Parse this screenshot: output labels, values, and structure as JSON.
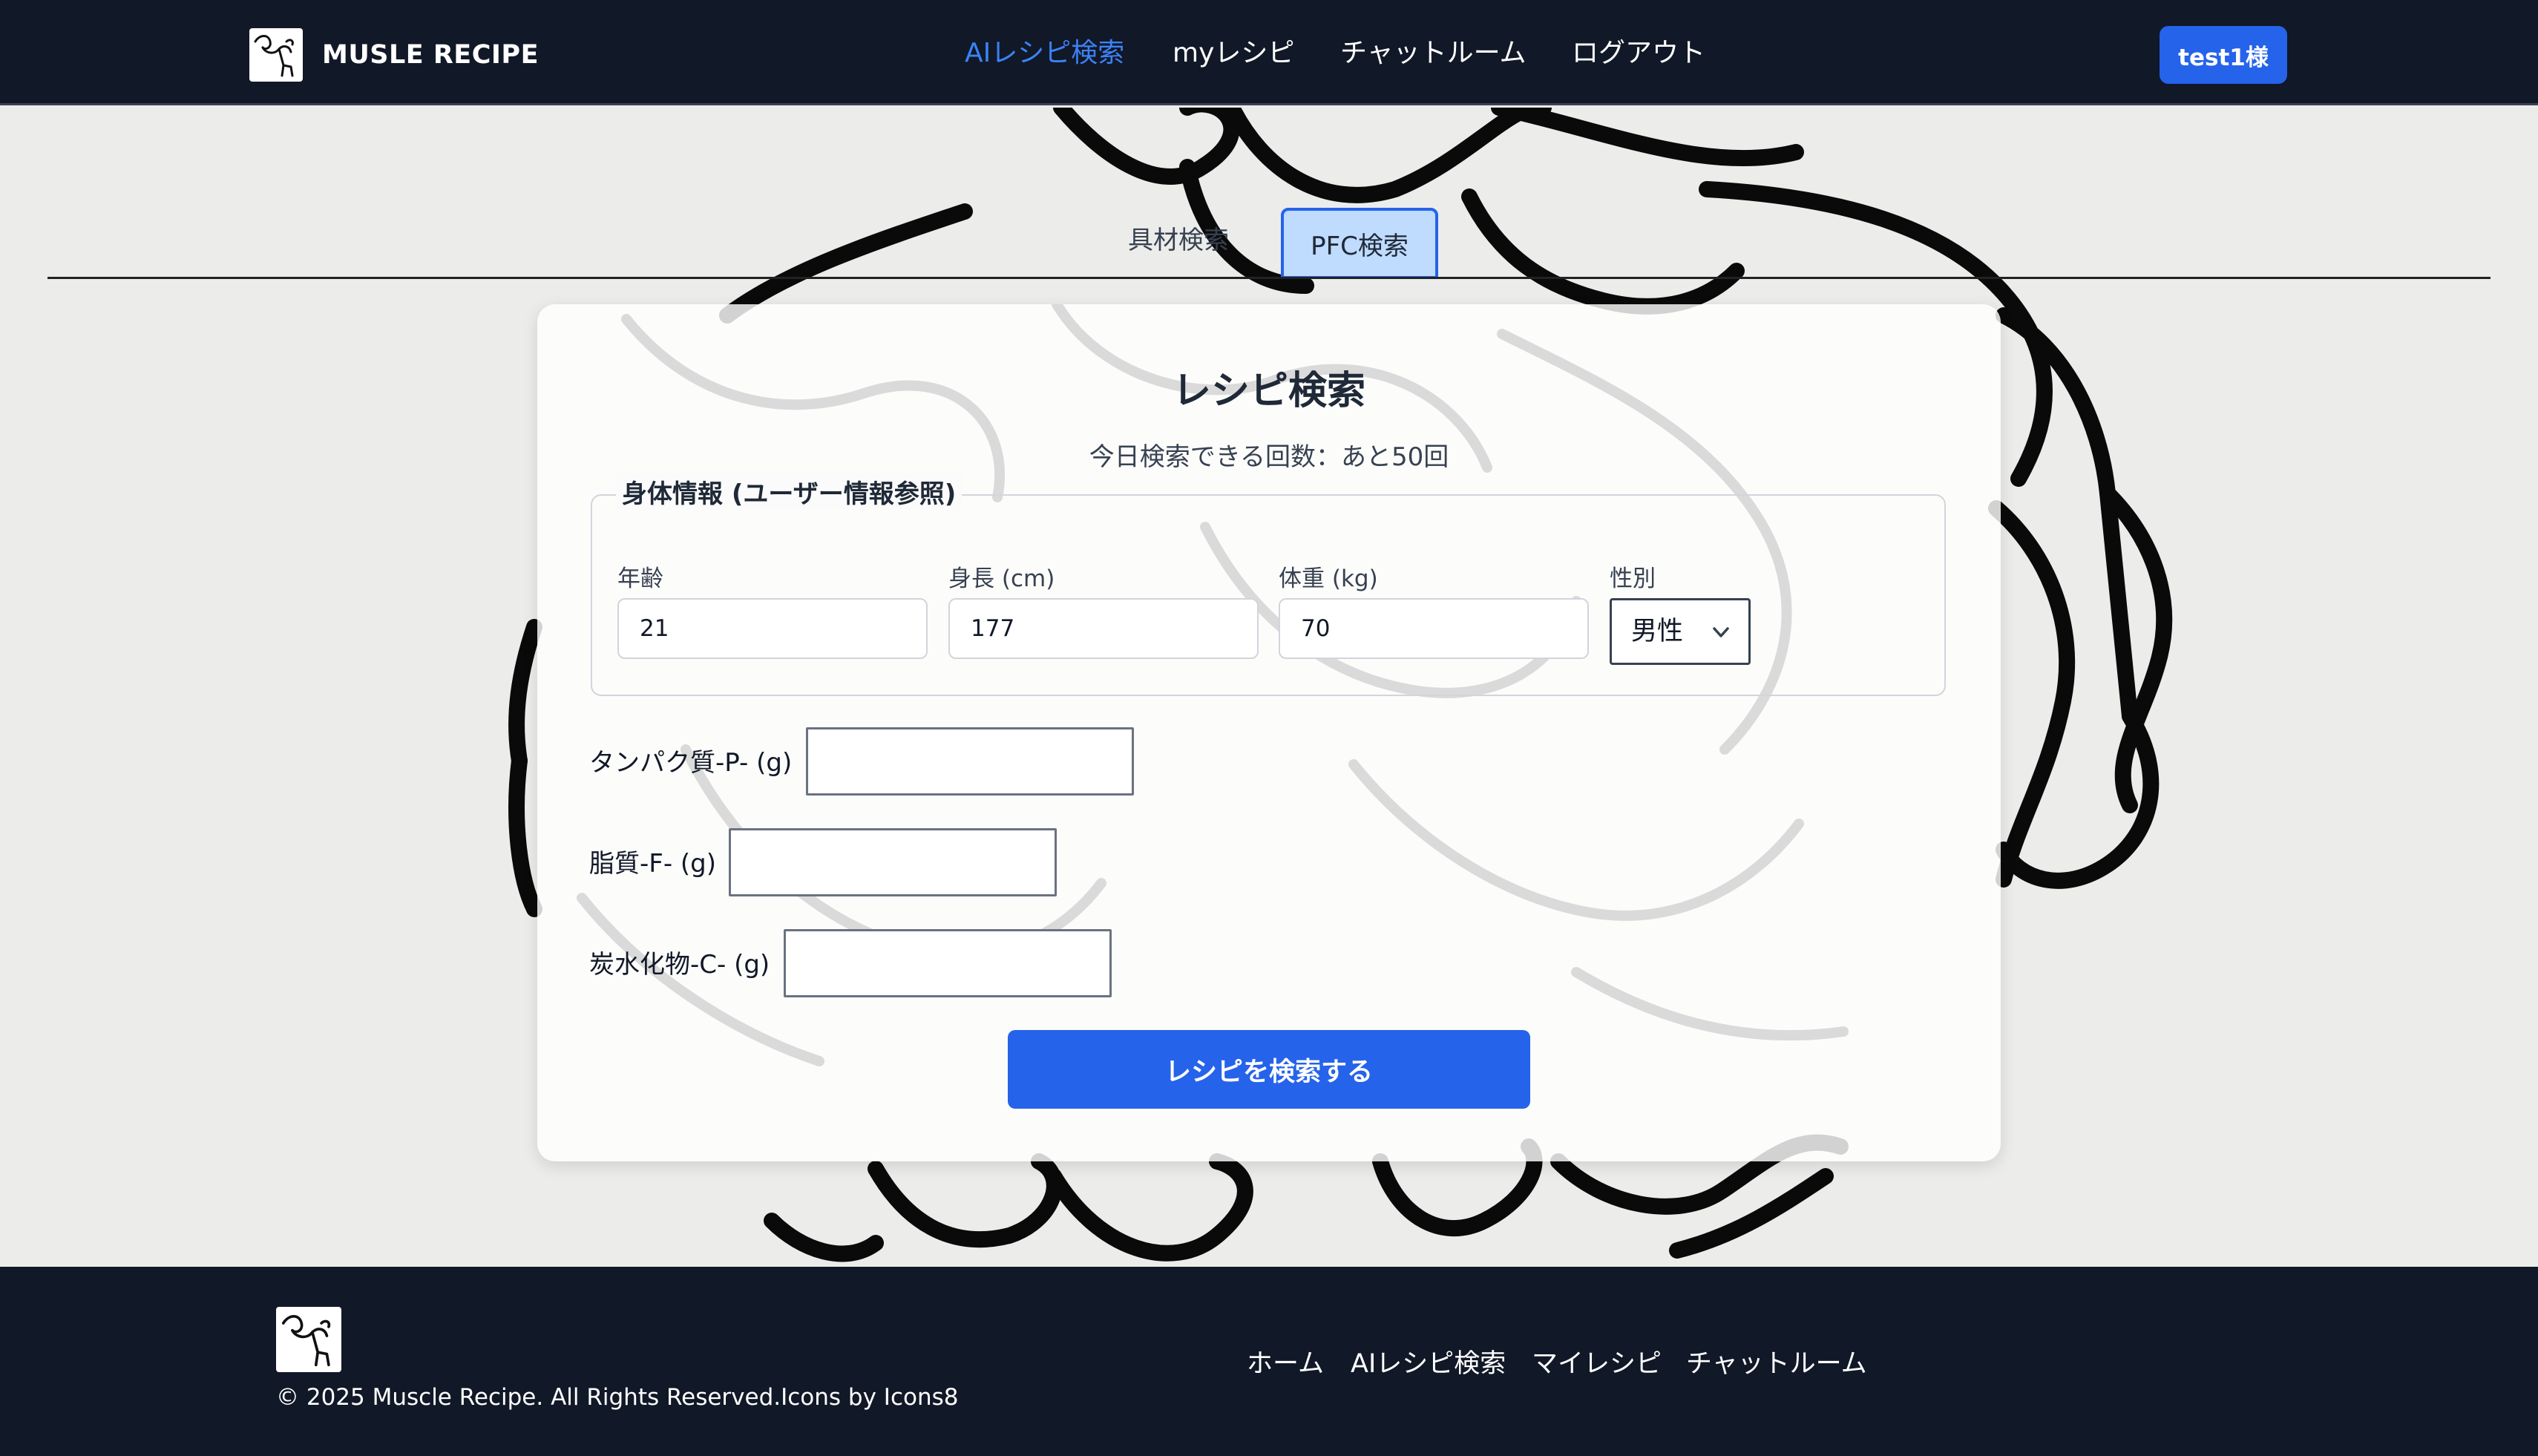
{
  "header": {
    "brand": "MUSLE RECIPE",
    "logo_icon": "muscle-flex-icon",
    "nav": [
      {
        "label": "AIレシピ検索",
        "active": true
      },
      {
        "label": "myレシピ",
        "active": false
      },
      {
        "label": "チャットルーム",
        "active": false
      },
      {
        "label": "ログアウト",
        "active": false
      }
    ],
    "user_button": "test1様"
  },
  "tabs": [
    {
      "label": "具材検索",
      "active": false
    },
    {
      "label": "PFC検索",
      "active": true
    }
  ],
  "card": {
    "title": "レシピ検索",
    "remaining": "今日検索できる回数：あと50回",
    "body_info": {
      "legend": "身体情報 (ユーザー情報参照)",
      "age": {
        "label": "年齢",
        "value": "21"
      },
      "height": {
        "label": "身長 (cm)",
        "value": "177"
      },
      "weight": {
        "label": "体重 (kg)",
        "value": "70"
      },
      "sex": {
        "label": "性別",
        "value": "男性"
      }
    },
    "nutrients": [
      {
        "label": "タンパク質-P- (g)",
        "value": ""
      },
      {
        "label": "脂質-F- (g)",
        "value": ""
      },
      {
        "label": "炭水化物-C- (g)",
        "value": ""
      }
    ],
    "submit": "レシピを検索する"
  },
  "footer": {
    "logo_icon": "muscle-flex-icon",
    "copyright": "© 2025 Muscle Recipe. All Rights Reserved.Icons by Icons8",
    "nav": [
      "ホーム",
      "AIレシピ検索",
      "マイレシピ",
      "チャットルーム"
    ]
  },
  "colors": {
    "header_bg": "#111827",
    "accent": "#2563eb",
    "active_nav": "#3b82f6",
    "tab_active_bg": "#bfdbfe"
  }
}
